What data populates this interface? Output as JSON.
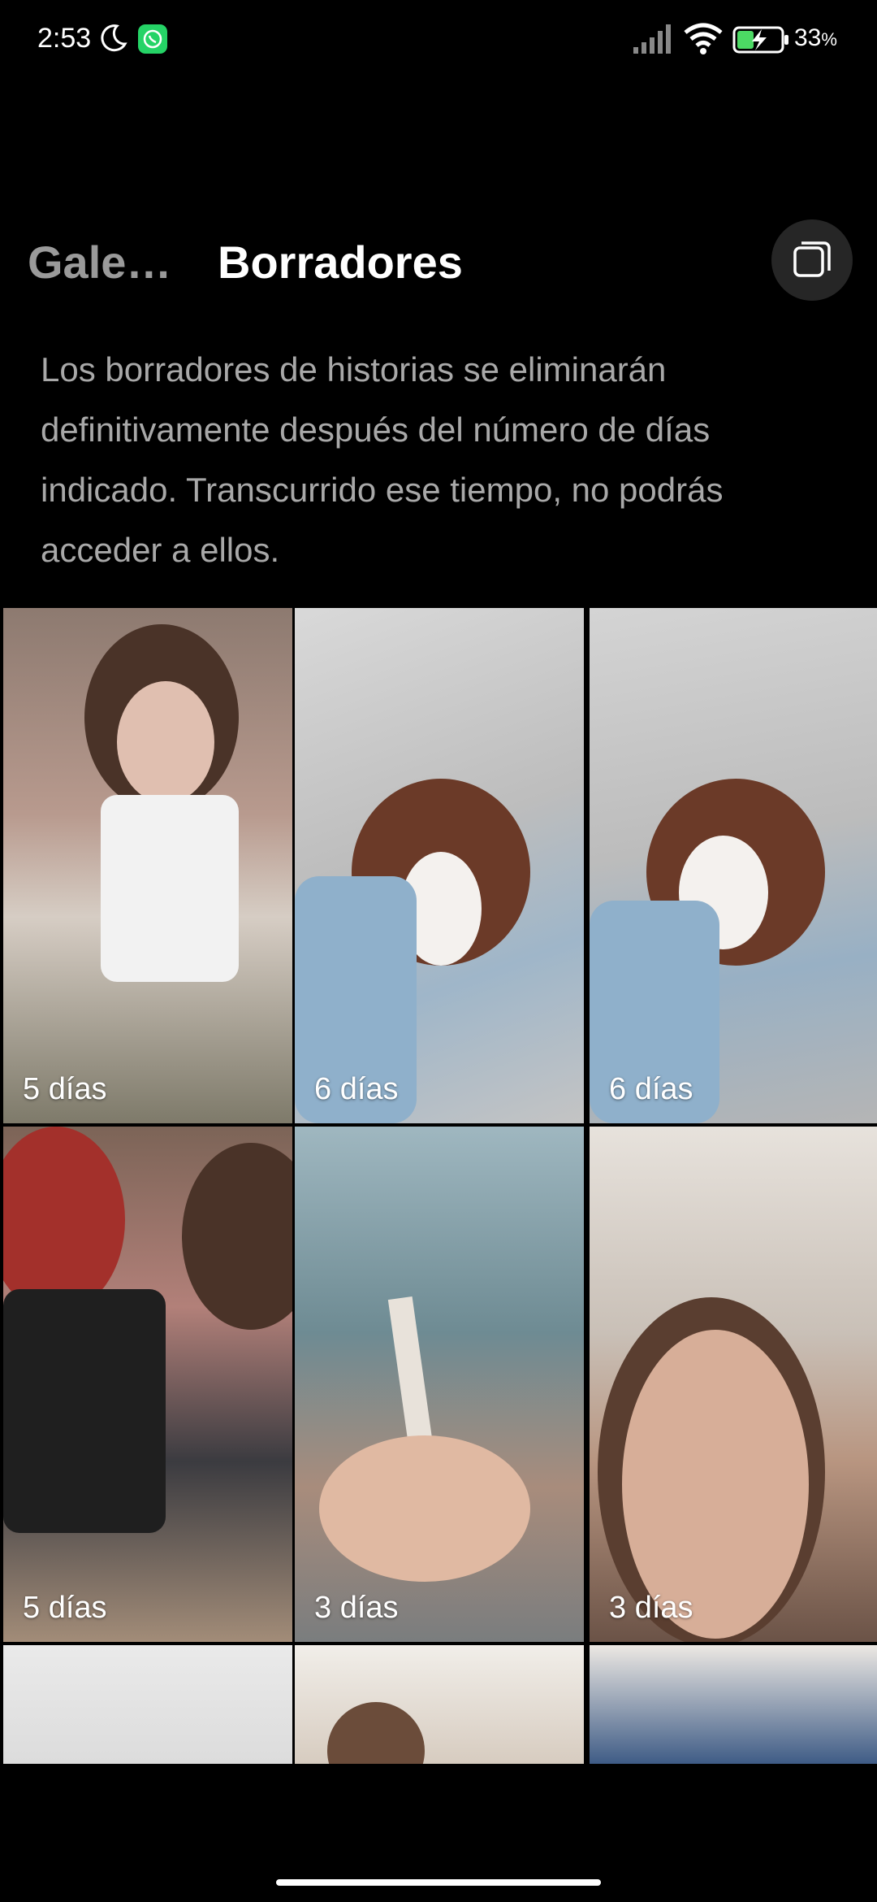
{
  "status_bar": {
    "time": "2:53",
    "battery_percent": "33",
    "battery_unit": "%",
    "icons": [
      "moon-icon",
      "whatsapp-icon",
      "signal-icon",
      "wifi-icon",
      "battery-charging-icon"
    ]
  },
  "header": {
    "tab_gallery": "Gale…",
    "tab_drafts": "Borradores",
    "select_multiple_icon": "multi-select-icon"
  },
  "description": "Los borradores de historias se eliminarán definitivamente después del número de días indicado. Transcurrido ese tiempo, no podrás acceder a ellos.",
  "drafts": [
    {
      "label": "5 días"
    },
    {
      "label": "6 días"
    },
    {
      "label": "6 días"
    },
    {
      "label": "5 días"
    },
    {
      "label": "3 días"
    },
    {
      "label": "3 días"
    },
    {
      "label": ""
    },
    {
      "label": ""
    },
    {
      "label": ""
    }
  ],
  "colors": {
    "background": "#000000",
    "description_text": "#a8a8a8",
    "inactive_tab": "#9a9a9a",
    "button_bg": "#262626",
    "whatsapp": "#25D366"
  }
}
